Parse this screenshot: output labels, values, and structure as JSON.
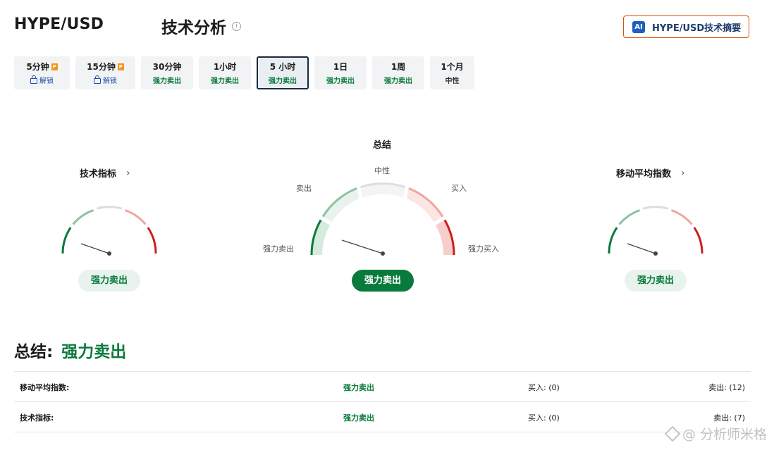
{
  "header": {
    "pair": "HYPE/USD",
    "title": "技术分析",
    "info_icon": "info-icon",
    "ai_badge": "AI",
    "ai_button": "HYPE/USD技术摘要"
  },
  "tabs": [
    {
      "label": "5分钟",
      "sub": "解锁",
      "locked": true,
      "pro": true
    },
    {
      "label": "15分钟",
      "sub": "解锁",
      "locked": true,
      "pro": true
    },
    {
      "label": "30分钟",
      "sub": "强力卖出"
    },
    {
      "label": "1小时",
      "sub": "强力卖出"
    },
    {
      "label": "5 小时",
      "sub": "强力卖出",
      "active": true
    },
    {
      "label": "1日",
      "sub": "强力卖出"
    },
    {
      "label": "1周",
      "sub": "强力卖出"
    },
    {
      "label": "1个月",
      "sub": "中性"
    }
  ],
  "gauges": {
    "left": {
      "title": "技术指标",
      "result": "强力卖出"
    },
    "center": {
      "title": "总结",
      "result": "强力卖出",
      "labels": {
        "neutral": "中性",
        "sell": "卖出",
        "buy": "买入",
        "strong_sell": "强力卖出",
        "strong_buy": "强力买入"
      }
    },
    "right": {
      "title": "移动平均指数",
      "result": "强力卖出"
    }
  },
  "summary": {
    "label": "总结:",
    "value": "强力卖出",
    "rows": [
      {
        "name": "移动平均指数:",
        "value": "强力卖出",
        "buy": "买入: (0)",
        "sell": "卖出: (12)"
      },
      {
        "name": "技术指标:",
        "value": "强力卖出",
        "buy": "买入: (0)",
        "sell": "卖出: (7)"
      }
    ]
  },
  "watermark": "@ 分析师米格",
  "colors": {
    "strong_sell": "#0a7a3c",
    "sell": "#8cc49f",
    "neutral": "#dddddd",
    "buy": "#efa6a0",
    "strong_buy": "#cc1f1a"
  }
}
